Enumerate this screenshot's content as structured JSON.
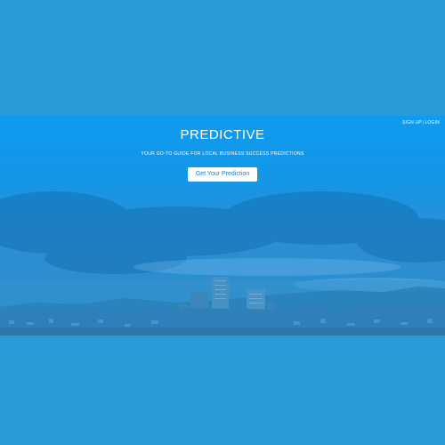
{
  "auth": {
    "signup_label": "SIGN UP",
    "login_label": "LOGIN"
  },
  "hero": {
    "title": "PREDICTIVE",
    "tagline": "YOUR GO-TO GUIDE FOR LOCAL BUSINESS SUCCESS PREDICTIONS",
    "cta_label": "Get Your Prediction"
  },
  "colors": {
    "page_background": "#2a9bd6",
    "hero_overlay": "#0e9bf0",
    "button_text": "#1a7fc4"
  }
}
